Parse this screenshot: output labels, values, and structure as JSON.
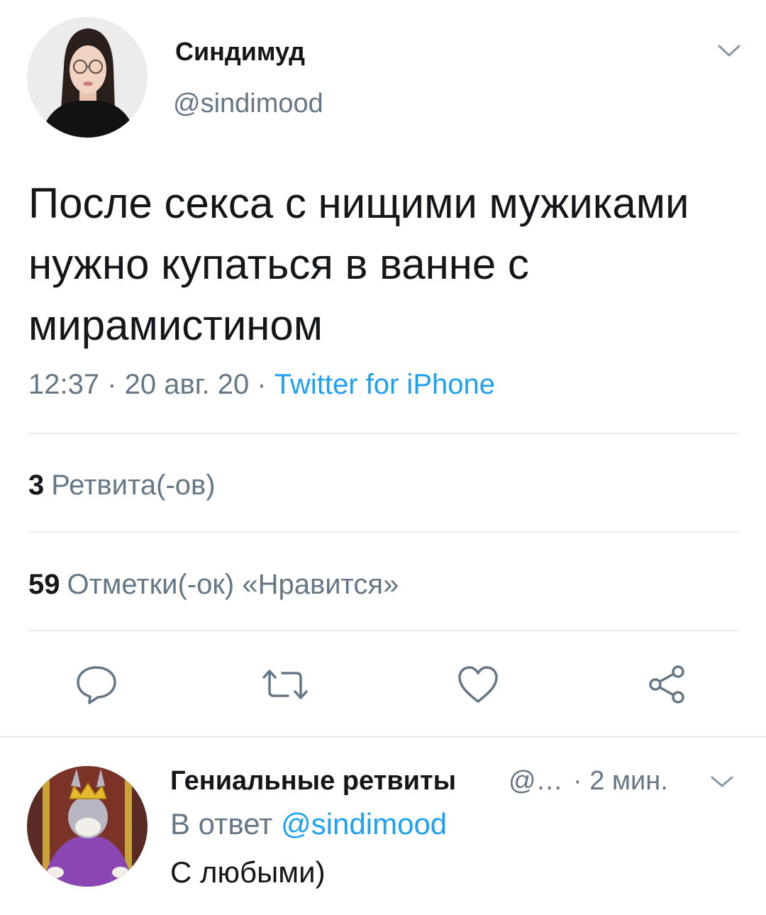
{
  "tweet": {
    "author": {
      "display_name": "Синдимуд",
      "handle": "@sindimood"
    },
    "text": "После секса с нищими мужиками нужно купаться в ванне с мирамистином",
    "time": "12:37",
    "separator": " · ",
    "date": "20 авг. 20",
    "source": "Twitter for iPhone",
    "stats": {
      "retweets_count": "3",
      "retweets_label": "Ретвита(-ов)",
      "likes_count": "59",
      "likes_label": "Отметки(-ок) «Нравится»"
    },
    "icons": {
      "menu": "chevron-down-icon",
      "reply": "reply-icon",
      "retweet": "retweet-icon",
      "like": "heart-icon",
      "share": "share-icon"
    }
  },
  "reply": {
    "display_name": "Гениальные ретвиты",
    "handle_truncated": "@…",
    "time": "· 2 мин.",
    "in_reply_prefix": "В ответ",
    "in_reply_mention": "@sindimood",
    "text": "С любыми)"
  },
  "colors": {
    "text_primary": "#14171a",
    "text_secondary": "#657786",
    "accent": "#1da1f2",
    "divider": "#e6ecf0"
  }
}
